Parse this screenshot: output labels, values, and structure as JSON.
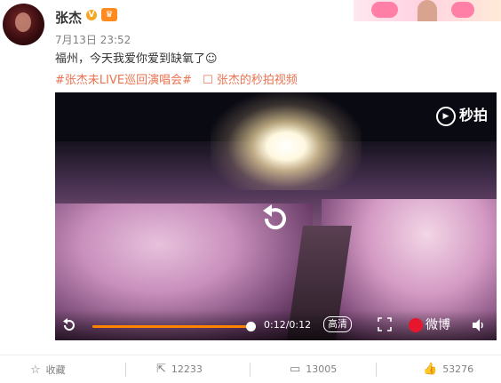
{
  "post": {
    "username": "张杰",
    "verified_badge": "V",
    "vip_badge": "♛",
    "timestamp": "7月13日 23:52",
    "content": "福州，今天我爱你爱到缺氧了☺",
    "hashtags": [
      "#张杰未LIVE巡回演唱会#",
      "☐ 张杰的秒拍视频"
    ]
  },
  "video": {
    "logo_text": "秒拍",
    "current_time": "0:12/0:12",
    "progress": 1.0,
    "quality_label": "高清",
    "weibo_label": "微博",
    "accent_color": "#ff8200"
  },
  "actions": {
    "favorite_label": "收藏",
    "repost_count": "12233",
    "comment_count": "13005",
    "like_count": "53276"
  },
  "colors": {
    "hashtag": "#eb7350",
    "meta": "#808080",
    "text": "#333333"
  }
}
